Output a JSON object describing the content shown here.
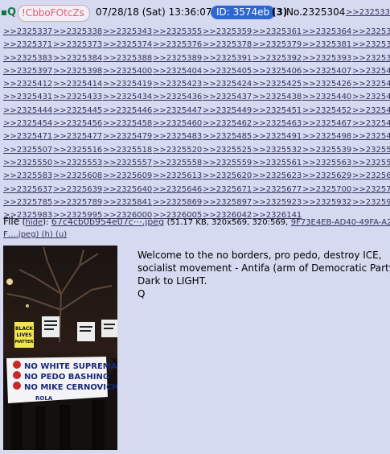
{
  "header": {
    "q_mark": "Q",
    "tripcode": "!CbboFOtcZs",
    "date": "07/28/18 (Sat) 13:36:07",
    "id_label": "ID: 3574eb",
    "count": "(3)",
    "post_number": "No.2325304",
    "quote_link": ">>2325331"
  },
  "backlinks": [
    ">>2325337",
    ">>2325338",
    ">>2325343",
    ">>2325355",
    ">>2325359",
    ">>2325361",
    ">>2325364",
    ">>2325365",
    ">>2325371",
    ">>2325373",
    ">>2325374",
    ">>2325376",
    ">>2325378",
    ">>2325379",
    ">>2325381",
    ">>2325382",
    ">>2325383",
    ">>2325384",
    ">>2325388",
    ">>2325389",
    ">>2325391",
    ">>2325392",
    ">>2325393",
    ">>2325394",
    ">>2325397",
    ">>2325398",
    ">>2325400",
    ">>2325404",
    ">>2325405",
    ">>2325406",
    ">>2325407",
    ">>2325408",
    ">>2325412",
    ">>2325414",
    ">>2325419",
    ">>2325423",
    ">>2325424",
    ">>2325425",
    ">>2325426",
    ">>2325427",
    ">>2325431",
    ">>2325433",
    ">>2325434",
    ">>2325436",
    ">>2325437",
    ">>2325438",
    ">>2325440",
    ">>2325441",
    ">>2325444",
    ">>2325445",
    ">>2325446",
    ">>2325447",
    ">>2325449",
    ">>2325451",
    ">>2325452",
    ">>2325453",
    ">>2325454",
    ">>2325456",
    ">>2325458",
    ">>2325460",
    ">>2325462",
    ">>2325463",
    ">>2325467",
    ">>2325468",
    ">>2325471",
    ">>2325477",
    ">>2325479",
    ">>2325483",
    ">>2325485",
    ">>2325491",
    ">>2325498",
    ">>2325499",
    ">>2325507",
    ">>2325516",
    ">>2325518",
    ">>2325520",
    ">>2325525",
    ">>2325532",
    ">>2325539",
    ">>2325540",
    ">>2325550",
    ">>2325553",
    ">>2325557",
    ">>2325558",
    ">>2325559",
    ">>2325561",
    ">>2325563",
    ">>2325578",
    ">>2325583",
    ">>2325608",
    ">>2325609",
    ">>2325613",
    ">>2325620",
    ">>2325623",
    ">>2325629",
    ">>2325631",
    ">>2325637",
    ">>2325639",
    ">>2325640",
    ">>2325646",
    ">>2325671",
    ">>2325677",
    ">>2325700",
    ">>2325724",
    ">>2325785",
    ">>2325789",
    ">>2325841",
    ">>2325869",
    ">>2325897",
    ">>2325923",
    ">>2325932",
    ">>2325954",
    ">>2325983",
    ">>2325995",
    ">>2326000",
    ">>2326005",
    ">>2326042",
    ">>2326141"
  ],
  "file": {
    "label": "File",
    "hide_open": "(",
    "hide": "hide",
    "hide_close": "):",
    "filename": "67c4cb0b954e07c⋯.jpeg",
    "meta": "(51.17 KB, 320x569, 320:569,",
    "original_name": "9F73E4EB-AD40-49FA-A2D3-",
    "line2": "F….jpeg) (h) (u)"
  },
  "message": [
    "Welcome to the no borders, pro pedo, destroy ICE,",
    "socialist movement - Antifa (arm of Democratic Party).",
    "Dark to LIGHT.",
    "Q"
  ],
  "image": {
    "sign_left": "BLACK LIVES MATTER",
    "banner": [
      "NO WHITE SUPREMACY",
      "NO PEDO BASHING",
      "NO MIKE CERNOVICH"
    ],
    "banner_footer": "ROLA"
  }
}
